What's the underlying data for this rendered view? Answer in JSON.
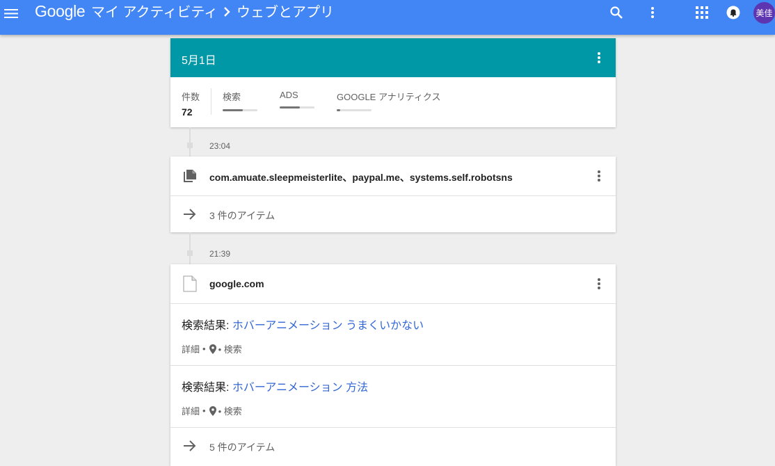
{
  "appbar": {
    "logo": "Google",
    "breadcrumb_1": "マイ アクティビティ",
    "breadcrumb_2": "ウェブとアプリ",
    "avatar_text": "美佳",
    "color": "#4285f4"
  },
  "summary": {
    "date": "5月1日",
    "header_color": "#0097a7",
    "total_label": "件数",
    "total_count": "72",
    "categories": [
      {
        "label": "検索",
        "fill": 0.58
      },
      {
        "label": "ADS",
        "fill": 0.58
      },
      {
        "label": "GOOGLE アナリティクス",
        "fill": 0.1
      }
    ]
  },
  "groups": [
    {
      "time": "23:04",
      "title": "com.amuate.sleepmeisterlite、paypal.me、systems.self.robotsns",
      "more_label": "3 件のアイテム",
      "icon": "file-copy-icon"
    },
    {
      "time": "21:39",
      "title": "google.com",
      "icon": "document-icon",
      "searches": [
        {
          "prefix": "検索結果: ",
          "query": "ホバーアニメーション うまくいかない",
          "meta_details": "詳細",
          "meta_sep": "•",
          "meta_product": "• 検索"
        },
        {
          "prefix": "検索結果: ",
          "query": "ホバーアニメーション 方法",
          "meta_details": "詳細",
          "meta_sep": "•",
          "meta_product": "• 検索"
        }
      ],
      "more_label": "5 件のアイテム"
    }
  ]
}
